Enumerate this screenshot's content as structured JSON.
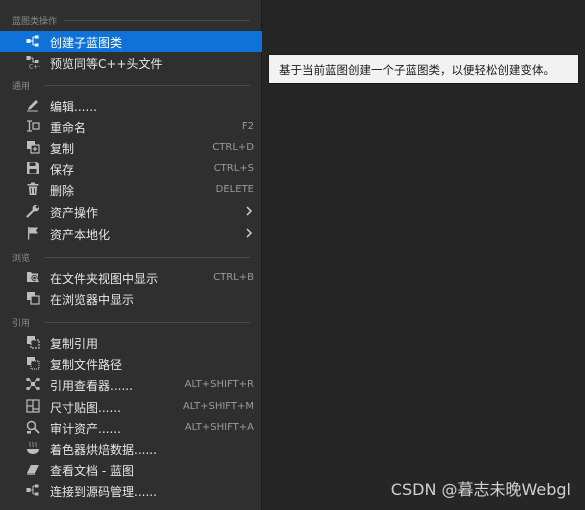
{
  "sections": {
    "blueprint": "蓝图类操作",
    "common": "通用",
    "browse": "浏览",
    "references": "引用"
  },
  "items": {
    "create_child": "创建子蓝图类",
    "preview_header": "预览同等C++头文件",
    "edit": "编辑......",
    "rename": "重命名",
    "rename_shortcut": "F2",
    "duplicate": "复制",
    "duplicate_shortcut": "CTRL+D",
    "save": "保存",
    "save_shortcut": "CTRL+S",
    "delete": "删除",
    "delete_shortcut": "DELETE",
    "asset_actions": "资产操作",
    "asset_localization": "资产本地化",
    "show_in_folder": "在文件夹视图中显示",
    "show_in_folder_shortcut": "CTRL+B",
    "show_in_explorer": "在浏览器中显示",
    "copy_reference": "复制引用",
    "copy_file_path": "复制文件路径",
    "reference_viewer": "引用查看器......",
    "reference_viewer_shortcut": "ALT+SHIFT+R",
    "size_map": "尺寸贴图......",
    "size_map_shortcut": "ALT+SHIFT+M",
    "audit_assets": "审计资产......",
    "audit_assets_shortcut": "ALT+SHIFT+A",
    "shader_cook": "着色器烘焙数据......",
    "view_docs": "查看文档 - 蓝图",
    "source_control": "连接到源码管理......"
  },
  "tooltip": "基于当前蓝图创建一个子蓝图类，以便轻松创建变体。",
  "watermark": "CSDN @暮志未晚Webgl",
  "colors": {
    "background": "#262626",
    "menu": "#2f2f2f",
    "selected": "#0f72d8",
    "tooltip_bg": "#f2f2f2"
  }
}
